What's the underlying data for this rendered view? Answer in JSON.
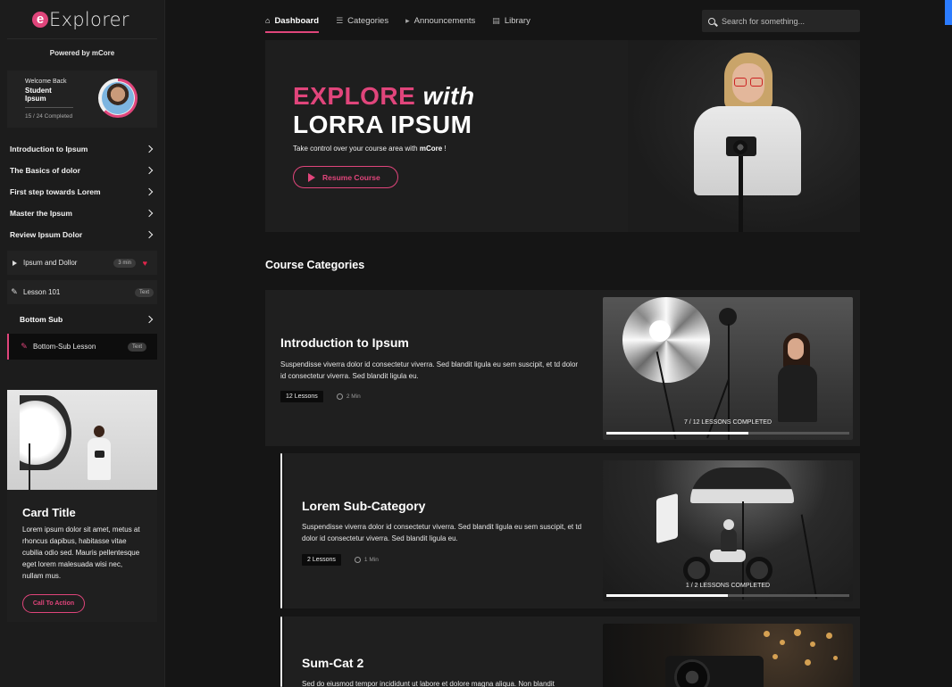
{
  "brand": {
    "logo_letter": "e",
    "logo_text": "Explorer",
    "powered_by": "Powered by mCore"
  },
  "welcome": {
    "greeting": "Welcome Back",
    "user": "Student Ipsum",
    "progress_text": "15 / 24 Completed",
    "progress_fraction": 0.625
  },
  "sidebar": {
    "menu": [
      {
        "label": "Introduction to Ipsum"
      },
      {
        "label": "The Basics of dolor"
      },
      {
        "label": "First step towards Lorem"
      },
      {
        "label": "Master the Ipsum"
      },
      {
        "label": "Review Ipsum Dolor"
      }
    ],
    "lessons": [
      {
        "label": "Ipsum and Dollor",
        "badge": "3 min",
        "icon": "play-icon",
        "favorited": true
      },
      {
        "label": "Lesson 101",
        "badge": "Text",
        "icon": "pencil-icon"
      }
    ],
    "sub_heading": "Bottom Sub",
    "sub_lesson": {
      "label": "Bottom-Sub Lesson",
      "badge": "Text",
      "icon": "pencil-icon"
    }
  },
  "card": {
    "title": "Card Title",
    "text": "Lorem ipsum dolor sit amet, metus at rhoncus dapibus, habitasse vitae cubilia odio sed. Mauris pellentesque eget lorem malesuada wisi nec, nullam mus.",
    "cta": "Call To Action"
  },
  "nav": {
    "tabs": [
      {
        "label": "Dashboard",
        "icon": "home-icon",
        "active": true
      },
      {
        "label": "Categories",
        "icon": "list-icon"
      },
      {
        "label": "Announcements",
        "icon": "megaphone-icon"
      },
      {
        "label": "Library",
        "icon": "library-icon"
      }
    ],
    "search_placeholder": "Search for something..."
  },
  "hero": {
    "title_accent": "EXPLORE",
    "title_with": "with",
    "title_main": "LORRA IPSUM",
    "subtitle_prefix": "Take control over your course area with",
    "subtitle_brand": "mCore",
    "subtitle_suffix": " !",
    "button": "Resume Course"
  },
  "section_title": "Course Categories",
  "courses": [
    {
      "title": "Introduction to Ipsum",
      "desc": "Suspendisse viverra dolor id consectetur viverra. Sed blandit ligula eu sem suscipit, et td dolor id consectetur viverra. Sed blandit ligula eu.",
      "lessons": "12 Lessons",
      "duration": "2 Min",
      "progress_text": "7 / 12  LESSONS COMPLETED",
      "progress_fraction": 0.583
    },
    {
      "title": "Lorem Sub-Category",
      "desc": "Suspendisse viverra dolor id consectetur viverra. Sed blandit ligula eu sem suscipit, et td dolor id consectetur viverra. Sed blandit ligula eu.",
      "lessons": "2 Lessons",
      "duration": "1 Min",
      "progress_text": "1 / 2  LESSONS COMPLETED",
      "progress_fraction": 0.5
    },
    {
      "title": "Sum-Cat 2",
      "desc": "Sed do eiusmod tempor incididunt ut labore et dolore magna aliqua. Non blandit"
    }
  ],
  "colors": {
    "accent": "#e0457b",
    "background": "#151515",
    "panel": "#1f1f1f"
  }
}
